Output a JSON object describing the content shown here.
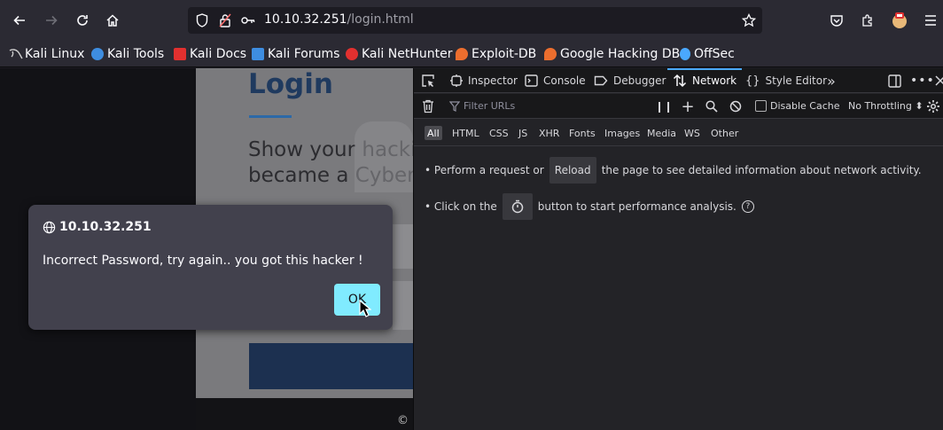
{
  "toolbar": {
    "back_icon": "arrow-left-icon",
    "forward_icon": "arrow-right-icon",
    "reload_icon": "reload-icon",
    "home_icon": "home-icon",
    "url_host": "10.10.32.251",
    "url_path": "/login.html"
  },
  "bookmarks": [
    {
      "label": "Kali Linux",
      "color": "#cfcfcf"
    },
    {
      "label": "Kali Tools",
      "color": "#3e8de0"
    },
    {
      "label": "Kali Docs",
      "color": "#e2302f"
    },
    {
      "label": "Kali Forums",
      "color": "#3e8de0"
    },
    {
      "label": "Kali NetHunter",
      "color": "#e2302f"
    },
    {
      "label": "Exploit-DB",
      "color": "#ec6e2e"
    },
    {
      "label": "Google Hacking DB",
      "color": "#ec6e2e"
    },
    {
      "label": "OffSec",
      "color": "#4aa8ff"
    }
  ],
  "page": {
    "title": "Login",
    "hero_line1": "Show your hacki",
    "hero_line2": "became a Cyber",
    "copyright": "©"
  },
  "dialog": {
    "origin": "10.10.32.251",
    "message": "Incorrect Password, try again.. you got this hacker !",
    "ok_label": "OK"
  },
  "devtools": {
    "tabs": [
      {
        "label": "Inspector",
        "icon": "inspector-icon"
      },
      {
        "label": "Console",
        "icon": "console-icon"
      },
      {
        "label": "Debugger",
        "icon": "debugger-icon"
      },
      {
        "label": "Network",
        "icon": "network-icon",
        "active": true
      },
      {
        "label": "Style Editor",
        "icon": "style-editor-icon"
      }
    ],
    "filter_placeholder": "Filter URLs",
    "disable_cache_label": "Disable Cache",
    "throttling_label": "No Throttling ⬍",
    "types": [
      "All",
      "HTML",
      "CSS",
      "JS",
      "XHR",
      "Fonts",
      "Images",
      "Media",
      "WS",
      "Other"
    ],
    "hint1_prefix": "• Perform a request or",
    "hint1_button": "Reload",
    "hint1_suffix": "the page to see detailed information about network activity.",
    "hint2_prefix": "• Click on the",
    "hint2_suffix": "button to start performance analysis.",
    "help_glyph": "?"
  }
}
